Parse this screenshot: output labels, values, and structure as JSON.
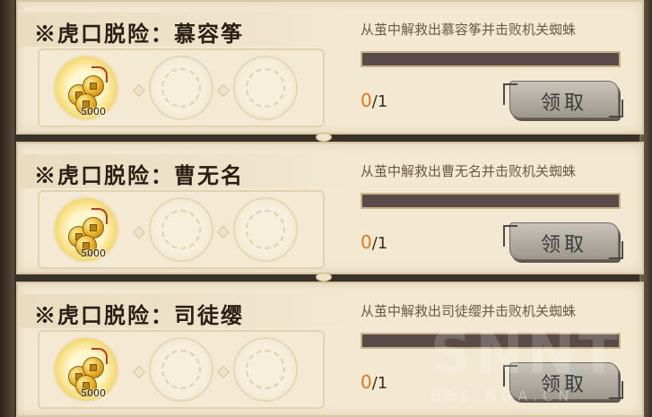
{
  "quests": [
    {
      "title": "※虎口脱险：慕容筝",
      "description": "从茧中解救出慕容筝并击败机关蜘蛛",
      "reward": {
        "icon": "copper-coins-icon",
        "count": "5000"
      },
      "progress": {
        "current": "0",
        "total": "/1",
        "fraction": 0
      },
      "claim_label": "领取"
    },
    {
      "title": "※虎口脱险：曹无名",
      "description": "从茧中解救出曹无名并击败机关蜘蛛",
      "reward": {
        "icon": "copper-coins-icon",
        "count": "5000"
      },
      "progress": {
        "current": "0",
        "total": "/1",
        "fraction": 0
      },
      "claim_label": "领取"
    },
    {
      "title": "※虎口脱险：司徒缨",
      "description": "从茧中解救出司徒缨并击败机关蜘蛛",
      "reward": {
        "icon": "copper-coins-icon",
        "count": "5000"
      },
      "progress": {
        "current": "0",
        "total": "/1",
        "fraction": 0
      },
      "claim_label": "领取"
    }
  ],
  "watermark": {
    "main": "SNNT",
    "sub": "BBS.NGA.CN"
  },
  "colors": {
    "card_bg": "#f3e9d2",
    "progress_track": "#5a4a4a",
    "progress_current": "#e07820",
    "button_gray": "#b4aea4"
  }
}
